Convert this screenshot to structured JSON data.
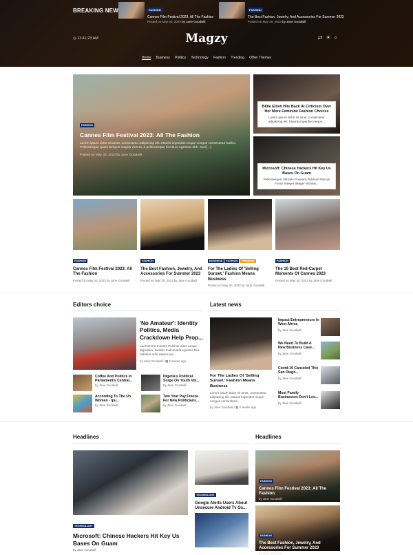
{
  "header": {
    "breaking_label": "BREAKING NEWS",
    "time": "11:41:23 AM",
    "logo": "Magzy",
    "ticker": [
      {
        "tag": "FASHION",
        "title": "Cannes Film Festival 2023: All The Fashion",
        "meta": "Posted on May 30, 2023",
        "author": "by Jane Goodwill"
      },
      {
        "tag": "FASHION",
        "title": "The Best Fashion, Jewelry, And Accessories For Summer 2023",
        "meta": "Posted on May 30, 2023",
        "author": "by Jane Goodwill"
      }
    ]
  },
  "nav": [
    "Home",
    "Business",
    "Politics",
    "Technology",
    "Fashion",
    "Trending",
    "Other Themes"
  ],
  "hero": {
    "tag": "FASHION",
    "title": "Cannes Film Festival 2023: All The Fashion",
    "excerpt": "Lorem ipsum dolor sit amet, consectetur adipiscing elit. Mauris imperdiet neque congue consectetur facilisi. Pellentesque quam tempus magna viverra, a pellentesque tincidunt egestas nibh. Sed [...]",
    "meta": "Posted on May 30, 2023 by Jane Goodwill"
  },
  "side_cards": [
    {
      "title": "Billie Eilish Hits Back At Criticism Over Her More Feminine Fashion Choices",
      "excerpt": "Lorem ipsum dolor sit amet, consectetur adipiscing elit. Mauris imperdiet neque..."
    },
    {
      "title": "Microsoft: Chinese Hackers Hit Key Us Bases On Guam",
      "excerpt": "Pellentesque Ultricies Posuere Pulvinar Rutrum Fusce Integer Integer Montes..."
    }
  ],
  "row4": [
    {
      "tags": [
        "FASHION"
      ],
      "title": "Cannes Film Festival 2023: All The Fashion",
      "meta": "Posted on May 30, 2023 by Jane Goodwill"
    },
    {
      "tags": [
        "FASHION"
      ],
      "title": "The Best Fashion, Jewelry, And Accessories For Summer 2023",
      "meta": "Posted on May 30, 2023 by Jane Goodwill"
    },
    {
      "tags": [
        "BUSINESS",
        "FASHION",
        "TRENDING"
      ],
      "title": "For The Ladies Of 'Selling Sunset,' Fashion Means Business",
      "meta": "Posted on May 30, 2023 by Jane Goodwill"
    },
    {
      "tags": [
        "FASHION"
      ],
      "title": "The 10 Best Red-Carpet Moments Of Cannes 2023",
      "meta": "Posted on May 30, 2023 by Jane Goodwill"
    }
  ],
  "editors": {
    "heading": "Editors choice",
    "main": {
      "title": "'No Amateur': Identity Politics, Media Crackdown Help Prop...",
      "excerpt": "Laoreet Est montes Pulvinar diam neque dignissim, facilisis malesuada egestas Nisi habitant odio sapien pur...",
      "author": "by Jane Goodwill",
      "ago": "2 weeks ago"
    },
    "items": [
      {
        "title": "Coffee And Politics In Parliament's Central...",
        "author": "by Jane Goodwill"
      },
      {
        "title": "Nigeria's Political Surge On Youth Vot...",
        "author": "by Jane Goodwill"
      },
      {
        "title": "According To The Un Women - ipu...",
        "author": "by Jane Goodwill"
      },
      {
        "title": "Two Year Pay Freeze For New Politicians...",
        "author": "by Jane Goodwill"
      }
    ]
  },
  "latest": {
    "heading": "Latest news",
    "main": {
      "title": "For The Ladies Of 'Selling Sunset,' Fashion Means Business",
      "excerpt": "Lorem ipsum dolor sit amet, consectetur adipiscing elit. Mauris imperdiet neque congue consectetur...",
      "author": "by Jane Goodwill",
      "ago": "2 weeks ago"
    },
    "items": [
      {
        "title": "Impact Entrepreneurs In West Africa",
        "author": "by Jane Goodwill"
      },
      {
        "title": "We Need To Build A New Business Case...",
        "author": "by Jane Goodwill"
      },
      {
        "title": "Covid-19 Canceled This San Diego...",
        "author": "by Jane Goodwill"
      },
      {
        "title": "Most Family Businesses Don't Loo...",
        "author": "by Jane Goodwill"
      }
    ]
  },
  "headlines": {
    "heading": "Headlines",
    "main": {
      "tag": "TECHNOLOGY",
      "title": "Microsoft: Chinese Hackers Hit Key Us Bases On Guam",
      "author": "by Jane Goodwill"
    },
    "mid": [
      {
        "tag": "TECHNOLOGY",
        "title": "Google Alerts Users About Unsecure Android Tv Os...",
        "author": "by Jane Goodwill"
      }
    ]
  },
  "headlines_right": {
    "heading": "Headlines",
    "items": [
      {
        "tag": "FASHION",
        "title": "Cannes Film Festival 2023: All The Fashion",
        "author": "by Jane Goodwill"
      },
      {
        "tag": "FASHION",
        "title": "The Best Fashion, Jewelry, And Accessories For Summer 2023",
        "author": "by Jane Goodwill"
      }
    ]
  }
}
